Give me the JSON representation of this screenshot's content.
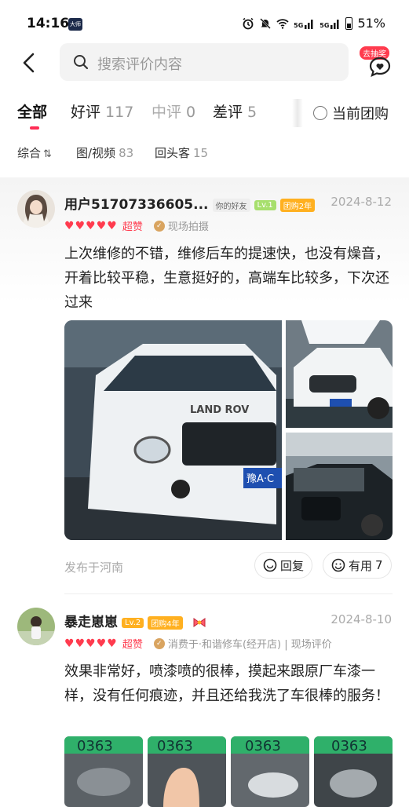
{
  "status_bar": {
    "time": "14:16",
    "app_badge": "大师",
    "battery": "51%",
    "net1": "5G",
    "net2": "5G"
  },
  "header": {
    "search_placeholder": "搜索评价内容",
    "lottery_badge": "去抽奖"
  },
  "tabs": [
    {
      "label": "全部",
      "count": ""
    },
    {
      "label": "好评",
      "count": "117"
    },
    {
      "label": "中评",
      "count": "0"
    },
    {
      "label": "差评",
      "count": "5"
    }
  ],
  "group_filter_label": "当前团购",
  "filters": [
    {
      "label": "综合",
      "count": ""
    },
    {
      "label": "图/视频",
      "count": "83"
    },
    {
      "label": "回头客",
      "count": "15"
    }
  ],
  "reviews": [
    {
      "user": "用户51707336605...",
      "friend_tag": "你的好友",
      "level": "Lv.1",
      "group_tag": "团购2年",
      "date": "2024-8-12",
      "praise": "超赞",
      "meta": "现场拍摄",
      "text": "上次维修的不错，维修后车的提速快，也没有燥音，开着比较平稳，生意挺好的，高端车比较多，下次还过来",
      "location": "发布于河南",
      "reply_label": "回复",
      "helpful_label": "有用",
      "helpful_count": "7",
      "plate": "豫A·C"
    },
    {
      "user": "暴走崽崽",
      "level": "Lv.2",
      "group_tag": "团购4年",
      "date": "2024-8-10",
      "praise": "超赞",
      "meta": "消费于·和谐修车(经开店) | 现场评价",
      "text": "效果非常好，喷漆喷的很棒，摸起来跟原厂车漆一样，没有任何痕迹，并且还给我洗了车很棒的服务！",
      "thumb_plates": [
        "0363",
        "0363",
        "0363",
        "0363"
      ]
    }
  ],
  "colors": {
    "accent": "#ff2d55",
    "heart": "#ff3b4e",
    "level1": "#a7df6d",
    "level2": "#ffb020"
  }
}
